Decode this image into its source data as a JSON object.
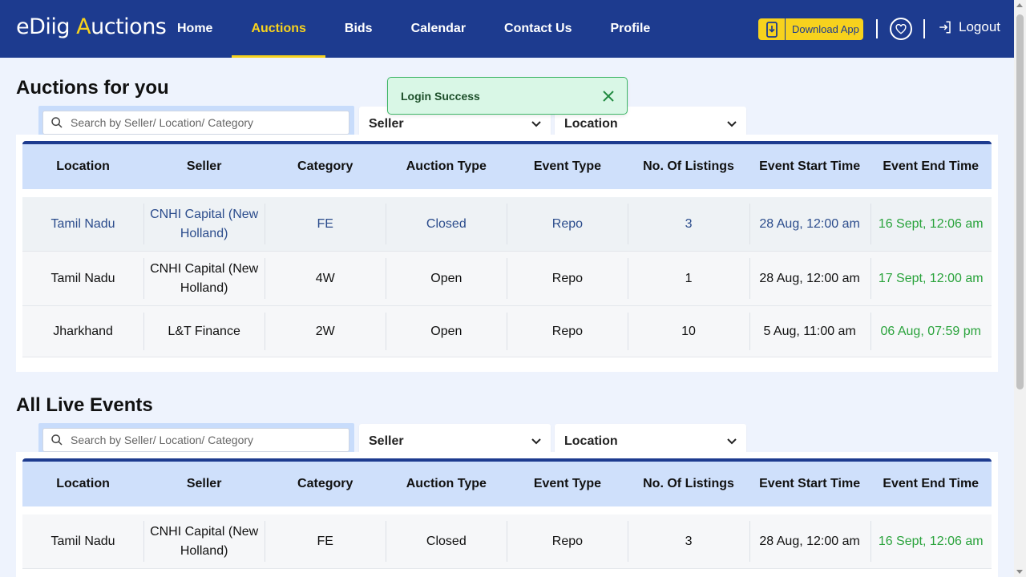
{
  "header": {
    "logo_prefix": "eDiig ",
    "logo_highlight": "A",
    "logo_suffix": "uctions",
    "nav": [
      {
        "label": "Home",
        "active": false
      },
      {
        "label": "Auctions",
        "active": true
      },
      {
        "label": "Bids",
        "active": false
      },
      {
        "label": "Calendar",
        "active": false
      },
      {
        "label": "Contact Us",
        "active": false
      },
      {
        "label": "Profile",
        "active": false
      }
    ],
    "download_label": "Download App",
    "logout_label": "Logout"
  },
  "toast": {
    "message": "Login Success"
  },
  "colors": {
    "primary": "#1d3b8f",
    "accent": "#f7d21d",
    "end_time": "#2aa33c",
    "success_bg": "#d9f7e6"
  },
  "icons": [
    "phone-download-icon",
    "heart-icon",
    "logout-icon",
    "search-icon",
    "chevron-down-icon",
    "close-icon"
  ],
  "sections": [
    {
      "title": "Auctions for you",
      "search_placeholder": "Search by Seller/ Location/ Category",
      "seller_dropdown": "Seller",
      "location_dropdown": "Location",
      "columns": [
        "Location",
        "Seller",
        "Category",
        "Auction Type",
        "Event Type",
        "No. Of Listings",
        "Event Start Time",
        "Event End Time"
      ],
      "rows": [
        [
          "Tamil Nadu",
          "CNHI Capital (New Holland)",
          "FE",
          "Closed",
          "Repo",
          "3",
          "28 Aug, 12:00 am",
          "16 Sept, 12:06 am"
        ],
        [
          "Tamil Nadu",
          "CNHI Capital (New Holland)",
          "4W",
          "Open",
          "Repo",
          "1",
          "28 Aug, 12:00 am",
          "17 Sept, 12:00 am"
        ],
        [
          "Jharkhand",
          "L&T Finance",
          "2W",
          "Open",
          "Repo",
          "10",
          "5 Aug, 11:00 am",
          "06 Aug, 07:59 pm"
        ]
      ]
    },
    {
      "title": "All Live Events",
      "search_placeholder": "Search by Seller/ Location/ Category",
      "seller_dropdown": "Seller",
      "location_dropdown": "Location",
      "columns": [
        "Location",
        "Seller",
        "Category",
        "Auction Type",
        "Event Type",
        "No. Of Listings",
        "Event Start Time",
        "Event End Time"
      ],
      "rows": [
        [
          "Tamil Nadu",
          "CNHI Capital (New Holland)",
          "FE",
          "Closed",
          "Repo",
          "3",
          "28 Aug, 12:00 am",
          "16 Sept, 12:06 am"
        ]
      ]
    }
  ]
}
